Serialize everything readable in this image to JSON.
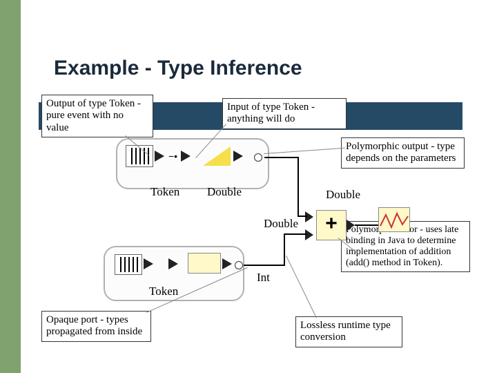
{
  "title": "Example - Type Inference",
  "annotations": {
    "output_token": "Output of type Token - pure event with no value",
    "input_token": "Input of type Token - anything will do",
    "poly_output": "Polymorphic output - type depends on the parameters",
    "poly_actor": "Polymorphic actor - uses late binding in Java to determine implementation of addition (add() method in Token).",
    "opaque_port": "Opaque port - types propagated from inside",
    "lossless": "Lossless runtime type conversion"
  },
  "labels": {
    "token1": "Token",
    "token2": "Token",
    "double1": "Double",
    "double2": "Double",
    "double3": "Double",
    "int1": "Int"
  },
  "colors": {
    "stripe": "#7fa26f",
    "bar": "#254a66",
    "box": "#fff9c9"
  }
}
